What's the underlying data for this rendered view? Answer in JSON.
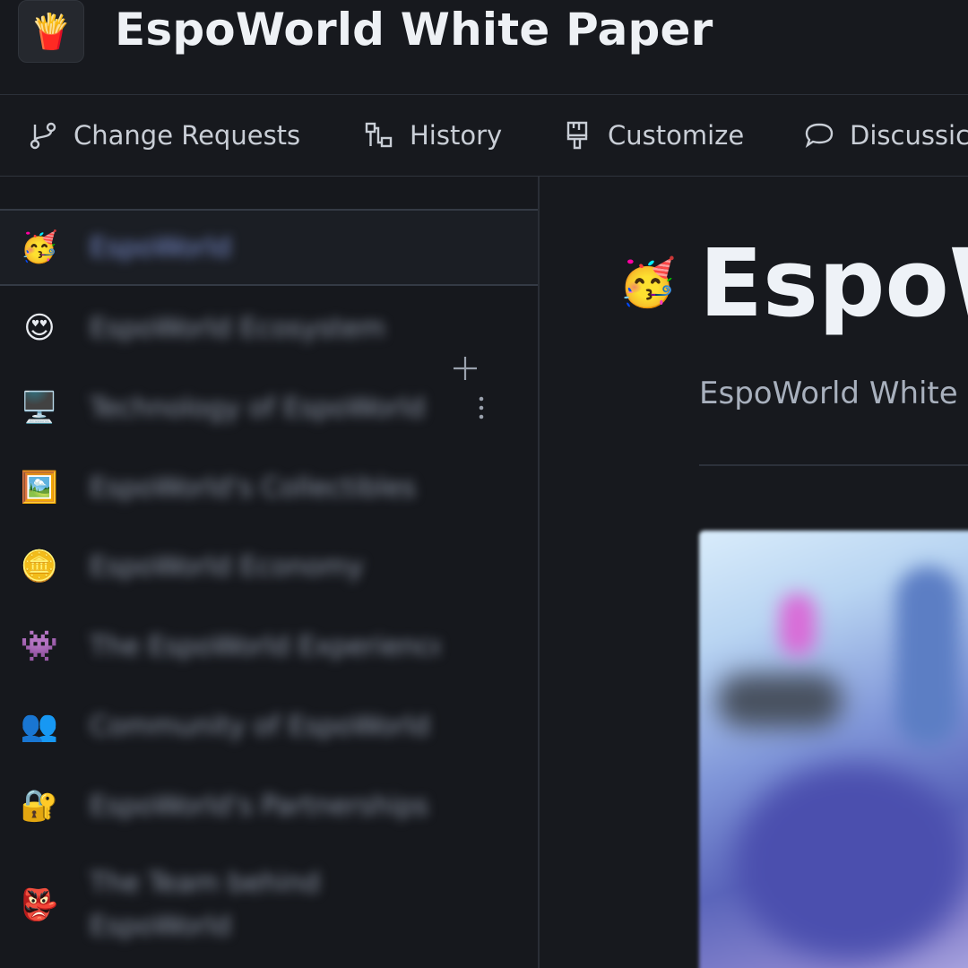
{
  "header": {
    "logo_icon": "fries-icon",
    "title": "EspoWorld White Paper"
  },
  "toolbar": {
    "items": [
      {
        "label": "Change Requests",
        "icon": "branch-icon"
      },
      {
        "label": "History",
        "icon": "history-icon"
      },
      {
        "label": "Customize",
        "icon": "brush-icon"
      },
      {
        "label": "Discussic",
        "icon": "chat-bubble-icon"
      }
    ]
  },
  "sidebar": {
    "items": [
      {
        "emoji": "🥳",
        "label": "EspoWorld",
        "active": true
      },
      {
        "emoji": "😍",
        "label": "EspoWorld Ecosystem"
      },
      {
        "emoji": "🖥️",
        "label": "Technology of EspoWorld"
      },
      {
        "emoji": "🖼️",
        "label": "EspoWorld's Collectibles"
      },
      {
        "emoji": "🪙",
        "label": "EspoWorld Economy"
      },
      {
        "emoji": "👾",
        "label": "The EspoWorld Experience"
      },
      {
        "emoji": "👥",
        "label": "Community of EspoWorld"
      },
      {
        "emoji": "🔐",
        "label": "EspoWorld's Partnerships"
      },
      {
        "emoji": "👺",
        "label": "The Team behind EspoWorld"
      }
    ],
    "add_icon": "plus-icon",
    "more_icon": "more-vertical-icon"
  },
  "main": {
    "emoji": "🥳",
    "title": "EspoW",
    "subtitle": "EspoWorld White F"
  },
  "colors": {
    "background": "#17191e",
    "accent": "#7f93d6",
    "border": "#2b3039"
  }
}
